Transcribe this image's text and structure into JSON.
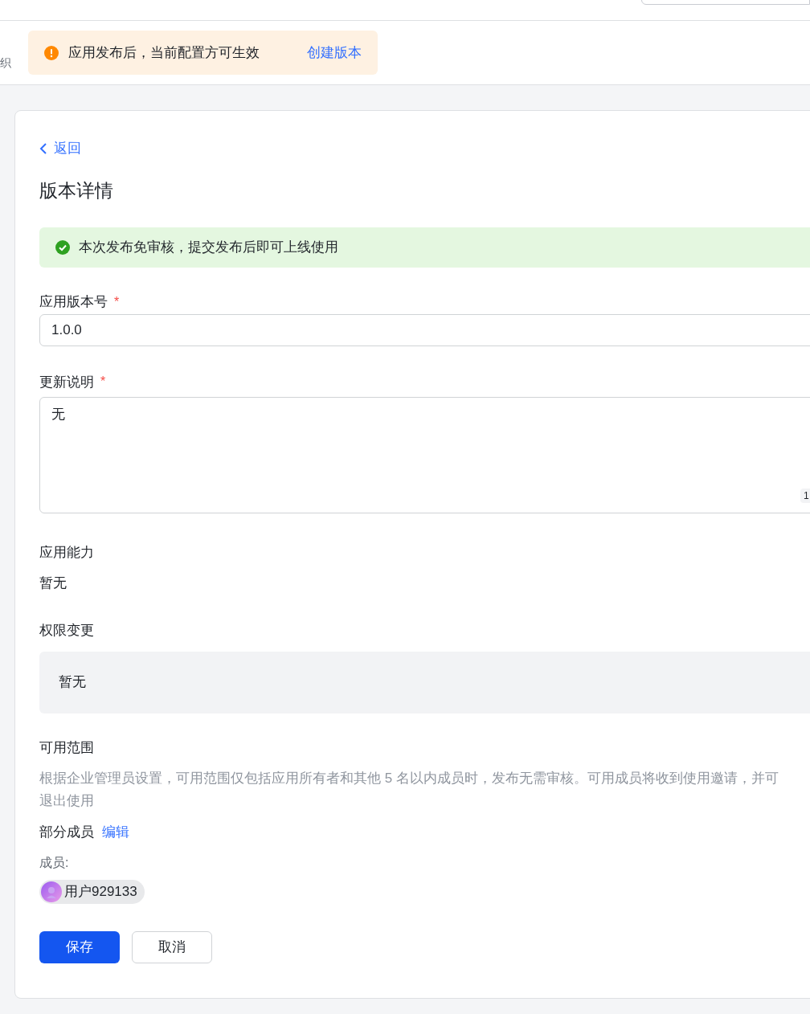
{
  "sidebar_fragment": "织",
  "notice": {
    "text": "应用发布后，当前配置方可生效",
    "link": "创建版本"
  },
  "back": "返回",
  "title": "版本详情",
  "success_alert": "本次发布免审核，提交发布后即可上线使用",
  "fields": [
    {
      "label": "应用版本号",
      "required_mark": "*",
      "kind": "input",
      "value": "1.0.0"
    },
    {
      "label": "更新说明",
      "required_mark": "*",
      "kind": "textarea",
      "value": "无",
      "counter": "1"
    }
  ],
  "capability": {
    "label": "应用能力",
    "value": "暂无"
  },
  "permission": {
    "label": "权限变更",
    "value": "暂无"
  },
  "scope": {
    "label": "可用范围",
    "description_lines": [
      "根据企业管理员设置，可用范围仅包括应用所有者和其他 5 名以内成员时，发布无需审核。可用成员将收到使用邀请，并可",
      "退出使用"
    ],
    "mode": "部分成员",
    "edit": "编辑",
    "members_label": "成员:",
    "members": [
      "用户929133"
    ]
  },
  "buttons": [
    {
      "label": "保存",
      "primary": true
    },
    {
      "label": "取消",
      "primary": false
    }
  ]
}
